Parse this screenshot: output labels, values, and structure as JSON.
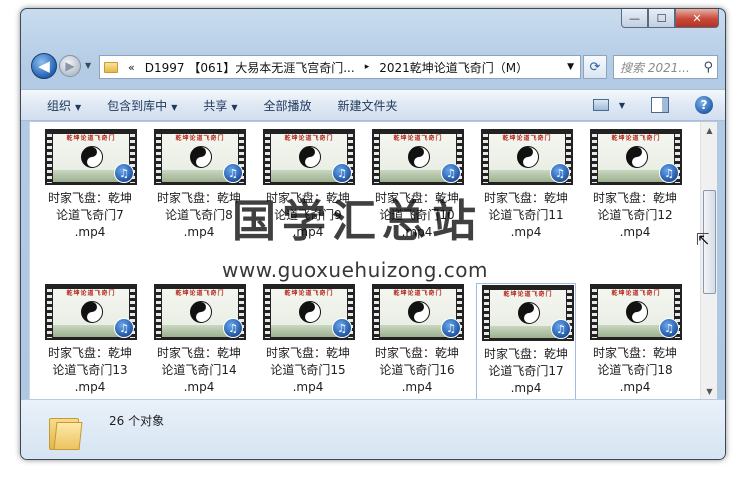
{
  "window": {
    "caption_buttons": {
      "minimize": "—",
      "maximize": "☐",
      "close": "✕"
    }
  },
  "address": {
    "chevron": "«",
    "crumb1": "D1997 【061】大易本无涯飞宫奇门...",
    "separator": "▸",
    "crumb2": "2021乾坤论道飞奇门（M）",
    "search_placeholder": "搜索 2021..."
  },
  "toolbar": {
    "organize": "组织",
    "include_library": "包含到库中",
    "share": "共享",
    "play_all": "全部播放",
    "new_folder": "新建文件夹"
  },
  "files": [
    {
      "line1": "时家飞盘：乾坤",
      "line2": "论道飞奇门7",
      "ext": ".mp4"
    },
    {
      "line1": "时家飞盘：乾坤",
      "line2": "论道飞奇门8",
      "ext": ".mp4"
    },
    {
      "line1": "时家飞盘：乾坤",
      "line2": "论道飞奇门9",
      "ext": ".mp4"
    },
    {
      "line1": "时家飞盘：乾坤",
      "line2": "论道飞奇门10",
      "ext": ".mp4"
    },
    {
      "line1": "时家飞盘：乾坤",
      "line2": "论道飞奇门11",
      "ext": ".mp4"
    },
    {
      "line1": "时家飞盘：乾坤",
      "line2": "论道飞奇门12",
      "ext": ".mp4"
    },
    {
      "line1": "时家飞盘：乾坤",
      "line2": "论道飞奇门13",
      "ext": ".mp4"
    },
    {
      "line1": "时家飞盘：乾坤",
      "line2": "论道飞奇门14",
      "ext": ".mp4"
    },
    {
      "line1": "时家飞盘：乾坤",
      "line2": "论道飞奇门15",
      "ext": ".mp4"
    },
    {
      "line1": "时家飞盘：乾坤",
      "line2": "论道飞奇门16",
      "ext": ".mp4"
    },
    {
      "line1": "时家飞盘：乾坤",
      "line2": "论道飞奇门17",
      "ext": ".mp4"
    },
    {
      "line1": "时家飞盘：乾坤",
      "line2": "论道飞奇门18",
      "ext": ".mp4"
    }
  ],
  "thumbnail_title": "乾坤论道飞奇门",
  "status": {
    "count": "26 个对象"
  },
  "watermark": {
    "cn": "国学汇总站",
    "url": "www.guoxuehuizong.com"
  }
}
